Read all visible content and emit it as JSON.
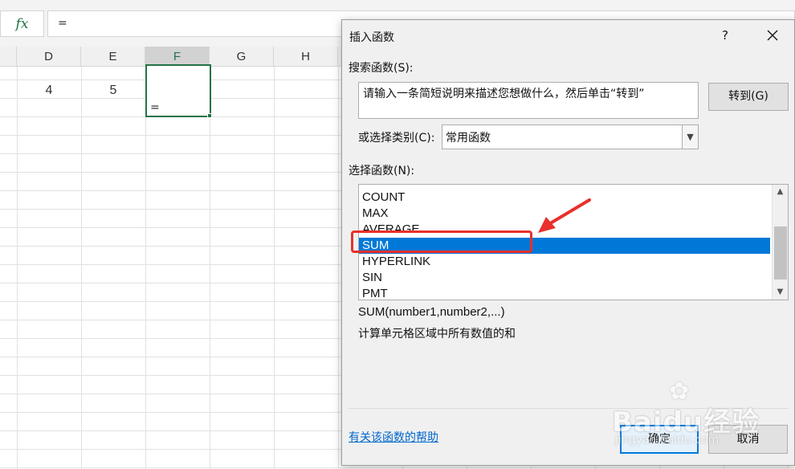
{
  "formula_bar": {
    "fx_label": "fx",
    "content": "="
  },
  "sheet": {
    "columns": [
      "D",
      "E",
      "F",
      "G",
      "H"
    ],
    "selected_column": "F",
    "cells": {
      "D1": "4",
      "E1": "5",
      "F1": "="
    }
  },
  "dialog": {
    "title": "插入函数",
    "help_symbol": "?",
    "close_symbol": "✕",
    "search_label": "搜索函数(S):",
    "search_text": "请输入一条简短说明来描述您想做什么，然后单击“转到”",
    "goto_button": "转到(G)",
    "category_label": "或选择类别(C):",
    "category_value": "常用函数",
    "function_label": "选择函数(N):",
    "functions": [
      "COUNT",
      "MAX",
      "AVERAGE",
      "SUM",
      "HYPERLINK",
      "SIN",
      "PMT"
    ],
    "selected_function": "SUM",
    "signature": "SUM(number1,number2,...)",
    "description": "计算单元格区域中所有数值的和",
    "help_link": "有关该函数的帮助",
    "ok_button": "确定",
    "cancel_button": "取消"
  },
  "watermark": {
    "brand": "Baidu经验",
    "domain": "jingyan.baidu.com"
  },
  "colors": {
    "excel_green": "#217346",
    "selection_blue": "#0078d7",
    "annotation_red": "#e8302c",
    "link_blue": "#0066cc"
  }
}
